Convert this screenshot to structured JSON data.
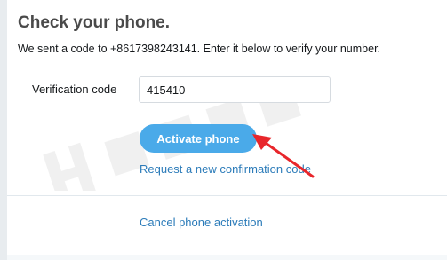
{
  "heading": {
    "title": "Check your phone.",
    "subtitle": "We sent a code to +8617398243141. Enter it below to verify your number."
  },
  "form": {
    "code_label": "Verification code",
    "code_value": "415410"
  },
  "actions": {
    "activate_label": "Activate phone",
    "resend_label": "Request a new confirmation code",
    "cancel_label": "Cancel phone activation"
  },
  "colors": {
    "accent_button": "#4aaae9",
    "link": "#2b7bb9",
    "annotation_arrow": "#e8262b"
  }
}
